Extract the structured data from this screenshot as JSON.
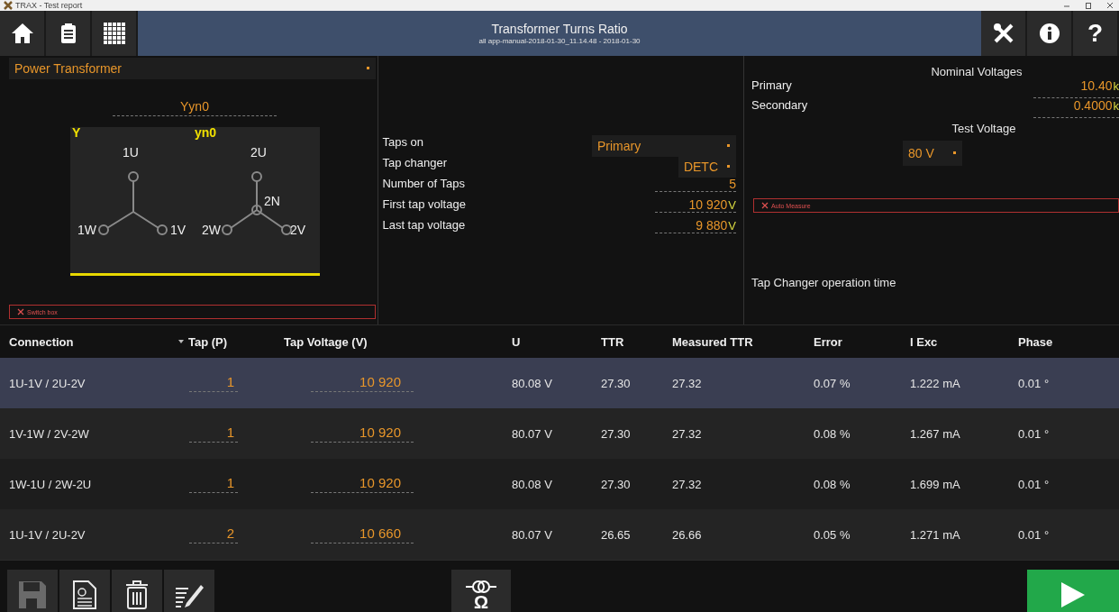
{
  "window": {
    "title": "TRAX - Test report"
  },
  "header": {
    "title": "Transformer Turns Ratio",
    "subtitle": "all app-manual-2018-01-30_11.14.48 - 2018-01-30",
    "left_buttons": [
      {
        "kind": "home"
      },
      {
        "kind": "report"
      },
      {
        "kind": "grid"
      }
    ],
    "right_buttons": [
      {
        "kind": "tools"
      },
      {
        "kind": "info"
      },
      {
        "kind": "help",
        "label": "?"
      }
    ]
  },
  "transformer": {
    "type": "Power Transformer",
    "vector_group": "Yyn0",
    "primary_symbol": "Y",
    "secondary_symbol": "yn0",
    "primary_terminals": [
      "1U",
      "1V",
      "1W"
    ],
    "secondary_terminals": [
      "2U",
      "2V",
      "2W"
    ],
    "neutral": "2N",
    "switch_box": {
      "label": "Switch box",
      "connected": false
    }
  },
  "taps": [
    {
      "label": "Taps on",
      "kind": "dropdown",
      "value": "Primary"
    },
    {
      "label": "Tap changer",
      "kind": "dropdown",
      "value": "DETC"
    },
    {
      "label": "Number of Taps",
      "kind": "input",
      "value": "5"
    },
    {
      "label": "First tap voltage",
      "kind": "input",
      "value": "10 920",
      "unit": "V"
    },
    {
      "label": "Last tap voltage",
      "kind": "input",
      "value": "9 880",
      "unit": "V"
    }
  ],
  "nominal": {
    "title": "Nominal Voltages",
    "fields": [
      {
        "label": "Primary",
        "value": "10.40",
        "unit": "k"
      },
      {
        "label": "Secondary",
        "value": "0.4000",
        "unit": "k"
      }
    ],
    "test_voltage_label": "Test Voltage",
    "test_voltage": "80 V",
    "auto_measure": {
      "label": "Auto Measure",
      "connected": false
    },
    "tap_changer_time_label": "Tap Changer operation time"
  },
  "table": {
    "columns": [
      {
        "label": "Connection",
        "sorted": false
      },
      {
        "label": "Tap (P)",
        "sorted": true
      },
      {
        "label": "Tap Voltage (V)",
        "sorted": false
      },
      {
        "label": "U",
        "sorted": false
      },
      {
        "label": "TTR",
        "sorted": false
      },
      {
        "label": "Measured TTR",
        "sorted": false
      },
      {
        "label": "Error",
        "sorted": false
      },
      {
        "label": "I Exc",
        "sorted": false
      },
      {
        "label": "Phase",
        "sorted": false
      }
    ],
    "rows": [
      {
        "selected": true,
        "cells": [
          "1U-1V / 2U-2V",
          "1",
          "10 920",
          "80.08 V",
          "27.30",
          "27.32",
          "0.07 %",
          "1.222 mA",
          "0.01 °"
        ]
      },
      {
        "selected": false,
        "cells": [
          "1V-1W / 2V-2W",
          "1",
          "10 920",
          "80.07 V",
          "27.30",
          "27.32",
          "0.08 %",
          "1.267 mA",
          "0.01 °"
        ]
      },
      {
        "selected": false,
        "cells": [
          "1W-1U / 2W-2U",
          "1",
          "10 920",
          "80.08 V",
          "27.30",
          "27.32",
          "0.08 %",
          "1.699 mA",
          "0.01 °"
        ]
      },
      {
        "selected": false,
        "cells": [
          "1U-1V / 2U-2V",
          "2",
          "10 660",
          "80.07 V",
          "26.65",
          "26.66",
          "0.05 %",
          "1.271 mA",
          "0.01 °"
        ]
      }
    ]
  },
  "toolbar": {
    "buttons": [
      {
        "kind": "save",
        "disabled": true
      },
      {
        "kind": "report",
        "disabled": false
      },
      {
        "kind": "delete",
        "disabled": false
      },
      {
        "kind": "edit",
        "disabled": false
      }
    ],
    "center": {
      "kind": "ttr",
      "label": "Ω"
    },
    "run": {
      "kind": "play"
    }
  }
}
